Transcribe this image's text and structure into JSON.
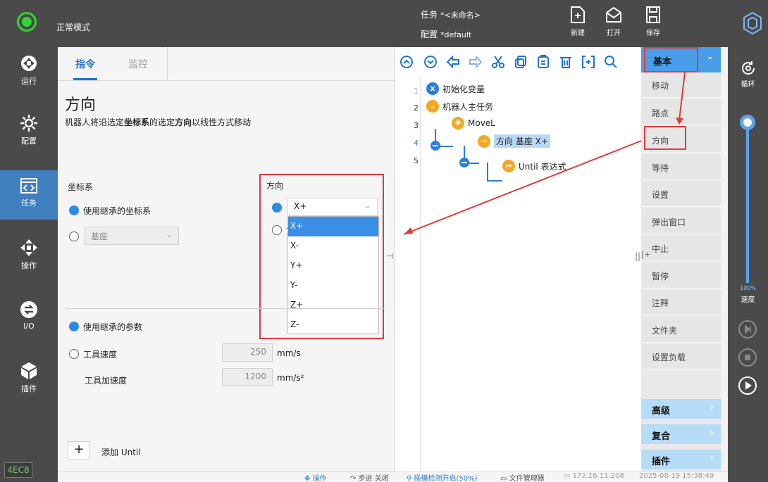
{
  "header": {
    "mode_label": "正常模式",
    "task_label": "任务",
    "task_value": "*<未命名>",
    "config_label": "配置",
    "config_value": "*default",
    "buttons": {
      "new": "新建",
      "open": "打开",
      "save": "保存"
    }
  },
  "left_nav": {
    "items": [
      {
        "label": "运行",
        "icon": "run-icon"
      },
      {
        "label": "配置",
        "icon": "config-gear-icon"
      },
      {
        "label": "任务",
        "icon": "task-code-icon",
        "active": true
      },
      {
        "label": "操作",
        "icon": "move-arrows-icon"
      },
      {
        "label": "I/O",
        "icon": "io-icon"
      },
      {
        "label": "插件",
        "icon": "plugin-cube-icon"
      }
    ],
    "version": "4EC8"
  },
  "right_nav": {
    "loop_label": "循环",
    "speed_percent": "100%",
    "speed_label": "速度",
    "speed_value": 1.0
  },
  "main": {
    "tabs": {
      "command": "指令",
      "monitor": "监控"
    },
    "title": "方向",
    "description": {
      "part1": "机器人将沿选定",
      "bold1": "坐标系",
      "part2": "的选定",
      "bold2": "方向",
      "part3": "以线性方式移动"
    },
    "coord": {
      "label": "坐标系",
      "inherit_option": "使用继承的坐标系",
      "base_select": "基座"
    },
    "direction": {
      "label": "方向",
      "selected": "X+",
      "second_radio_partial": "方",
      "options": [
        "X+",
        "X-",
        "Y+",
        "Y-",
        "Z+",
        "Z-"
      ]
    },
    "params": {
      "inherit_label": "使用继承的参数",
      "tool_speed_label": "工具速度",
      "tool_speed_value": "250",
      "tool_speed_unit": "mm/s",
      "tool_accel_label": "工具加速度",
      "tool_accel_value": "1200",
      "tool_accel_unit": "mm/s²"
    },
    "add_until_label": "添加 Until"
  },
  "tree": {
    "nodes": [
      {
        "line": "1",
        "label": "初始化变量"
      },
      {
        "line": "2",
        "label": "机器人主任务"
      },
      {
        "line": "3",
        "label": "MoveL"
      },
      {
        "line": "4",
        "label": "方向 基座 X+"
      },
      {
        "line": "5",
        "label": "Until 表达式"
      }
    ]
  },
  "palette": {
    "header": "基本",
    "items": [
      "移动",
      "路点",
      "方向",
      "等待",
      "设置",
      "弹出窗口",
      "中止",
      "暂停",
      "注释",
      "文件夹",
      "设置负载"
    ],
    "categories": [
      "高级",
      "复合",
      "插件"
    ]
  },
  "status_bar": {
    "operate": "操作",
    "step": "步进 关闭",
    "collision": "碰撞检测开启(50%)",
    "file_mgr": "文件管理器",
    "ip": "172.16.11.208",
    "datetime": "2025-08-19 15:38:49"
  },
  "colors": {
    "accent": "#1c74d8",
    "annotation_red": "#e03a3a",
    "mode_green": "#35d335",
    "node_orange": "#f5a623"
  }
}
